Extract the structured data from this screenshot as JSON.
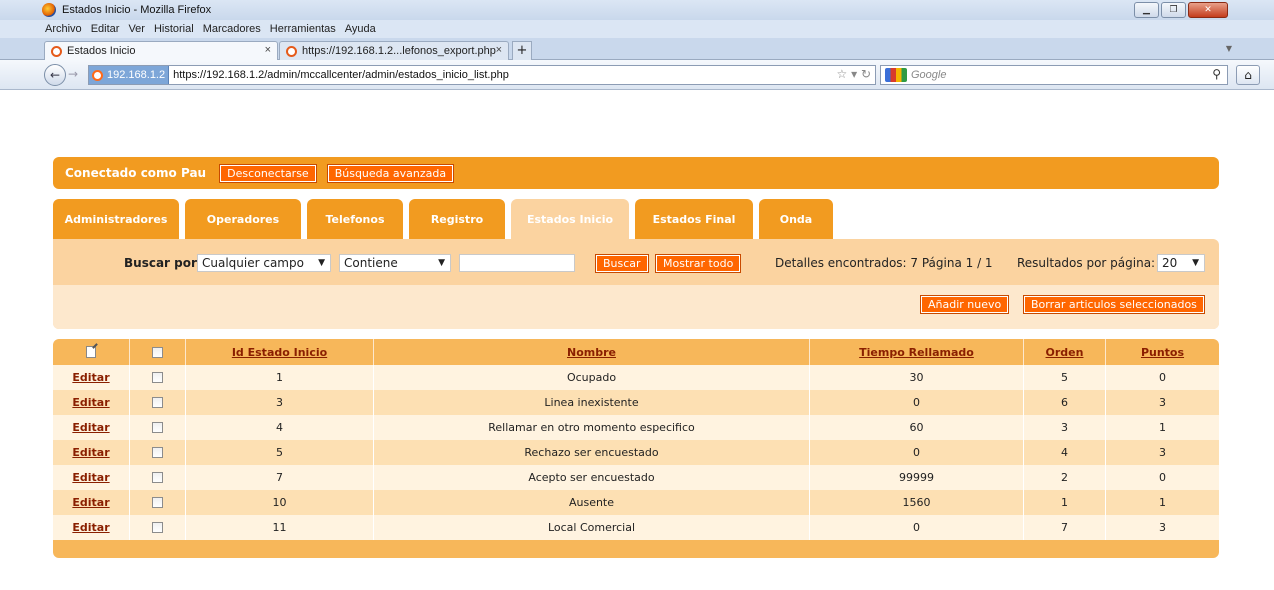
{
  "browser": {
    "window_title": "Estados Inicio - Mozilla Firefox",
    "menu": [
      "Archivo",
      "Editar",
      "Ver",
      "Historial",
      "Marcadores",
      "Herramientas",
      "Ayuda"
    ],
    "tabs": [
      {
        "label": "Estados Inicio"
      },
      {
        "label": "https://192.168.1.2...lefonos_export.php"
      }
    ],
    "site_badge": "192.168.1.2",
    "url": "https://192.168.1.2/admin/mccallcenter/admin/estados_inicio_list.php",
    "search_placeholder": "Google"
  },
  "topbar": {
    "connected_as": "Conectado como Pau",
    "logout_label": "Desconectarse",
    "advanced_search_label": "Búsqueda avanzada"
  },
  "tabs": [
    "Administradores",
    "Operadores",
    "Telefonos",
    "Registro",
    "Estados Inicio",
    "Estados Final",
    "Onda"
  ],
  "active_tab": "Estados Inicio",
  "search": {
    "label": "Buscar por",
    "field_select": "Cualquier campo",
    "op_select": "Contiene",
    "query": "",
    "search_button": "Buscar",
    "show_all_button": "Mostrar todo",
    "info": "Detalles encontrados: 7   Página 1 / 1",
    "results_per_page_label": "Resultados por página:",
    "results_per_page": "20"
  },
  "actions": {
    "add_new": "Añadir nuevo",
    "delete_selected": "Borrar articulos seleccionados"
  },
  "table": {
    "columns": [
      "Id Estado Inicio",
      "Nombre",
      "Tiempo Rellamado",
      "Orden",
      "Puntos"
    ],
    "edit_label": "Editar",
    "rows": [
      {
        "id": "1",
        "nombre": "Ocupado",
        "tiempo": "30",
        "orden": "5",
        "puntos": "0"
      },
      {
        "id": "3",
        "nombre": "Linea inexistente",
        "tiempo": "0",
        "orden": "6",
        "puntos": "3"
      },
      {
        "id": "4",
        "nombre": "Rellamar en otro momento especifico",
        "tiempo": "60",
        "orden": "3",
        "puntos": "1"
      },
      {
        "id": "5",
        "nombre": "Rechazo ser encuestado",
        "tiempo": "0",
        "orden": "4",
        "puntos": "3"
      },
      {
        "id": "7",
        "nombre": "Acepto ser encuestado",
        "tiempo": "99999",
        "orden": "2",
        "puntos": "0"
      },
      {
        "id": "10",
        "nombre": "Ausente",
        "tiempo": "1560",
        "orden": "1",
        "puntos": "1"
      },
      {
        "id": "11",
        "nombre": "Local Comercial",
        "tiempo": "0",
        "orden": "7",
        "puntos": "3"
      }
    ]
  },
  "colors": {
    "orange": "#f29b20",
    "button": "#ff6600",
    "panel": "#fbd3a0",
    "link": "#8a1f00"
  }
}
